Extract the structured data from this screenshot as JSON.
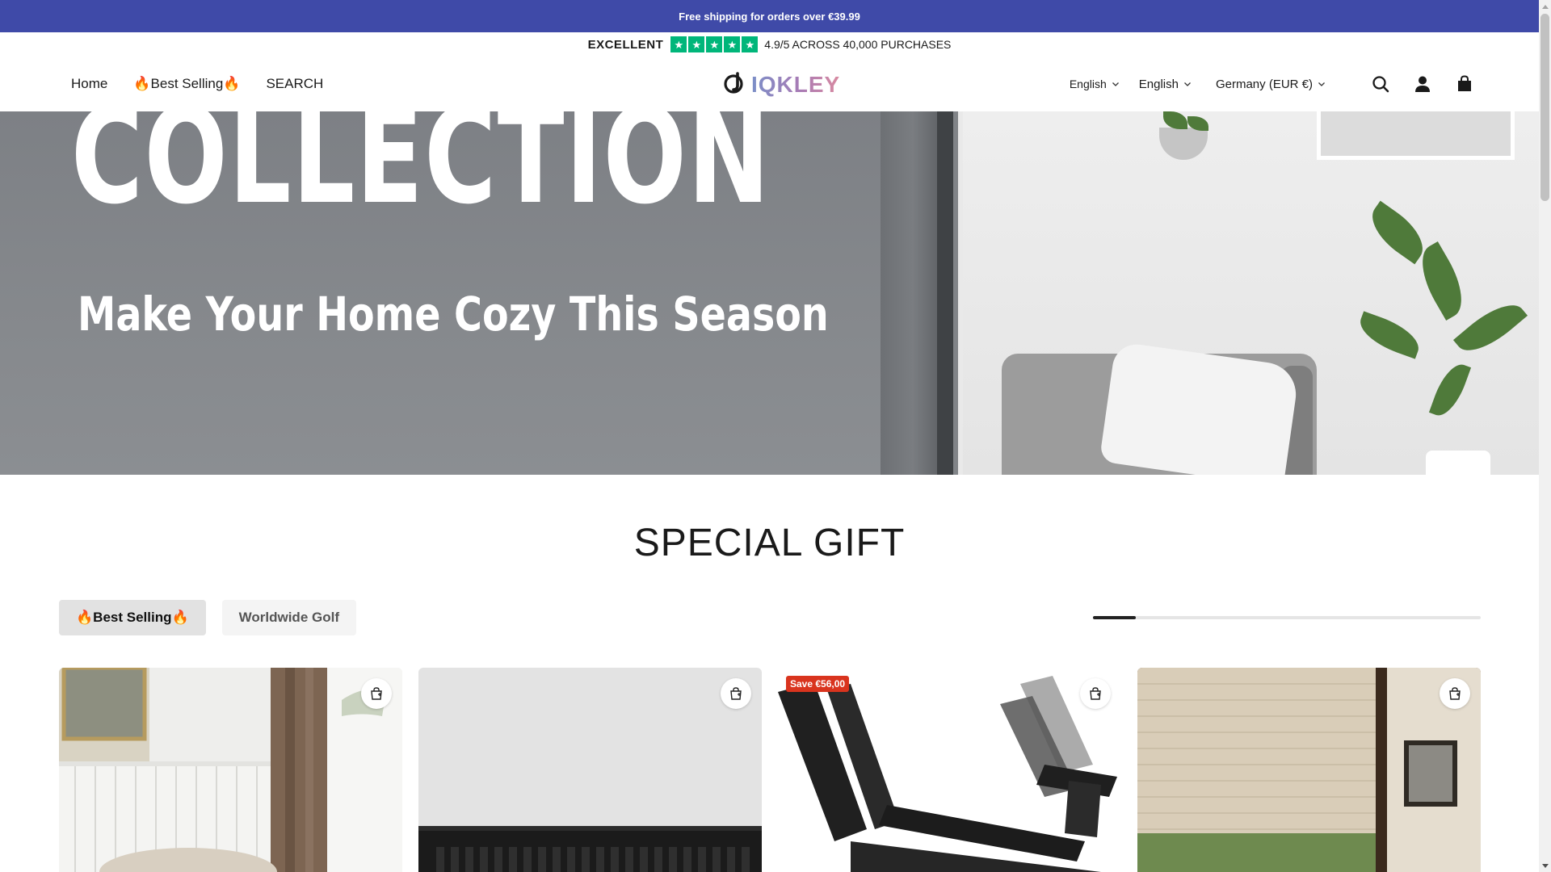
{
  "announcement": {
    "text": "Free shipping for orders over €39.99"
  },
  "trust": {
    "label": "EXCELLENT",
    "stars": 5,
    "star_glyph": "★",
    "star_color": "#00b67a",
    "rating_text": "4.9/5 ACROSS 40,000 PURCHASES"
  },
  "header": {
    "nav": [
      {
        "label": "Home"
      },
      {
        "label": "🔥Best Selling🔥"
      },
      {
        "label": "SEARCH"
      }
    ],
    "logo": {
      "text": "IQKLEY",
      "icon": "logo-mark-icon"
    },
    "language_selector_1": "English",
    "language_selector_2": "English",
    "country_selector": "Germany (EUR €)",
    "icons": [
      "search-icon",
      "account-icon",
      "cart-icon"
    ]
  },
  "hero": {
    "heading": "COLLECTION",
    "subheading": "Make Your Home Cozy This Season"
  },
  "special_gift": {
    "title": "SPECIAL GIFT",
    "tabs": [
      {
        "label": "🔥Best Selling🔥",
        "active": true
      },
      {
        "label": "Worldwide Golf",
        "active": false
      }
    ],
    "carousel_progress": 0.11
  },
  "products": [
    {
      "badge": "",
      "icon": "quick-add-cart-icon"
    },
    {
      "badge": "",
      "icon": "quick-add-cart-icon"
    },
    {
      "badge": "Save €56,00",
      "icon": "quick-add-cart-icon"
    },
    {
      "badge": "",
      "icon": "quick-add-cart-icon"
    }
  ],
  "colors": {
    "announcement_bg": "#3f4aa8",
    "trustpilot_green": "#00b67a",
    "sale_badge": "#d9341e"
  }
}
